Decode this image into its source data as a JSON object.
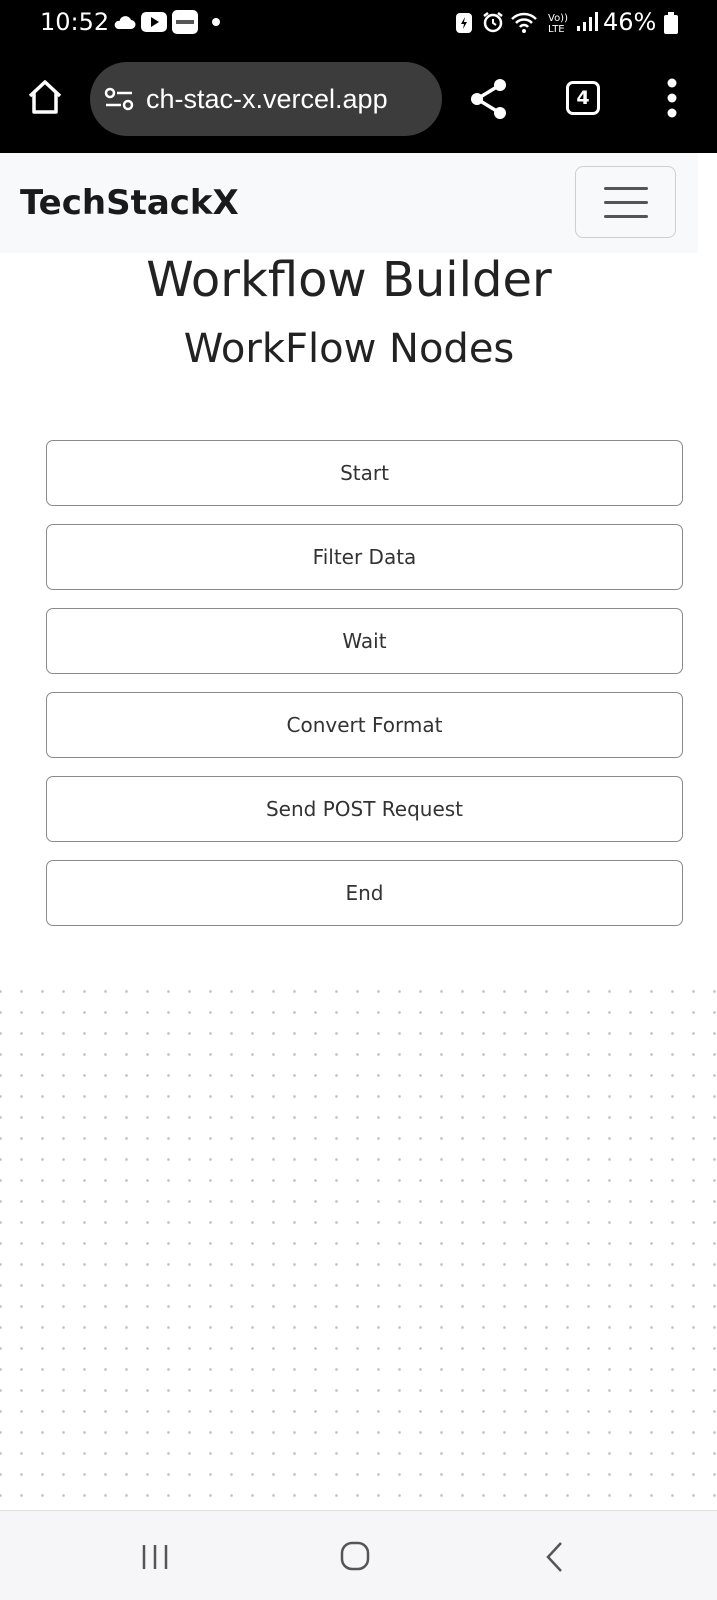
{
  "status_bar": {
    "time": "10:52",
    "battery": "46%",
    "icons": [
      "cloud-icon",
      "youtube-icon",
      "paytm-icon",
      "dot-icon",
      "data-saver-icon",
      "alarm-icon",
      "wifi-icon",
      "volte-icon",
      "signal-icon",
      "battery-icon"
    ]
  },
  "browser": {
    "url": "ch-stac-x.vercel.app",
    "tab_count": "4",
    "icons": [
      "home-icon",
      "site-settings-icon",
      "share-icon",
      "more-vert-icon"
    ]
  },
  "navbar": {
    "brand": "TechStackX",
    "toggler_icon": "hamburger-icon"
  },
  "main": {
    "title": "Workflow Builder",
    "subtitle": "WorkFlow Nodes",
    "nodes": [
      {
        "label": "Start"
      },
      {
        "label": "Filter Data"
      },
      {
        "label": "Wait"
      },
      {
        "label": "Convert Format"
      },
      {
        "label": "Send POST Request"
      },
      {
        "label": "End"
      }
    ]
  },
  "android_nav": {
    "icons": [
      "recent-apps-icon",
      "home-circle-icon",
      "back-icon"
    ]
  },
  "colors": {
    "status_bar_bg": "#000000",
    "url_pill_bg": "#3c3c3c",
    "navbar_bg": "#f8f9fa",
    "node_border": "#8a8a8a",
    "canvas_dot": "#c6c6c6",
    "system_nav_bg": "#f6f6f8"
  }
}
